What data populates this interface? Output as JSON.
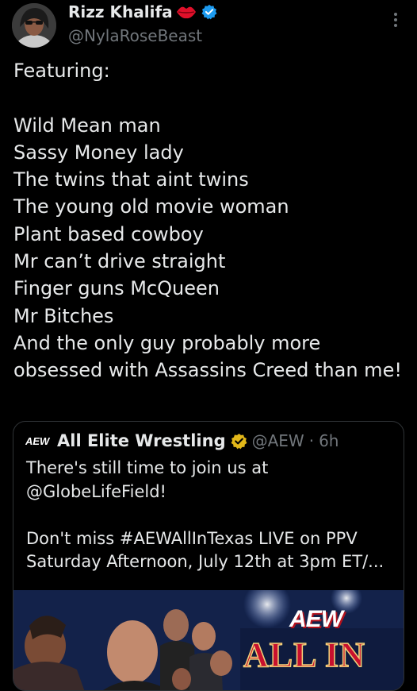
{
  "author": {
    "display_name": "Rizz Khalifa",
    "handle": "@NylaRoseBeast",
    "emoji_icon": "lips-icon",
    "verified_color": "#1d9bf0"
  },
  "tweet": {
    "text": "Featuring:\n\nWild Mean man\nSassy Money lady\nThe twins that aint twins\nThe young old movie woman\nPlant based cowboy\nMr can’t drive straight\nFinger guns McQueen\nMr Bitches\nAnd the only guy probably more obsessed with Assassins Creed than me!"
  },
  "quote": {
    "logo_text": "AEW",
    "name": "All Elite Wrestling",
    "handle": "@AEW",
    "separator": "·",
    "time": "6h",
    "verified_color": "#e2b719",
    "text": "There's still time to join us at @GlobeLifeField!\n\nDon't miss #AEWAllInTexas LIVE on PPV Saturday Afternoon, July 12th at 3pm ET/...",
    "media": {
      "logo_text": "AEW",
      "headline": "ALL IN"
    }
  },
  "colors": {
    "background": "#000000",
    "text": "#e7e9ea",
    "secondary": "#71767b",
    "border": "#2f3336"
  }
}
